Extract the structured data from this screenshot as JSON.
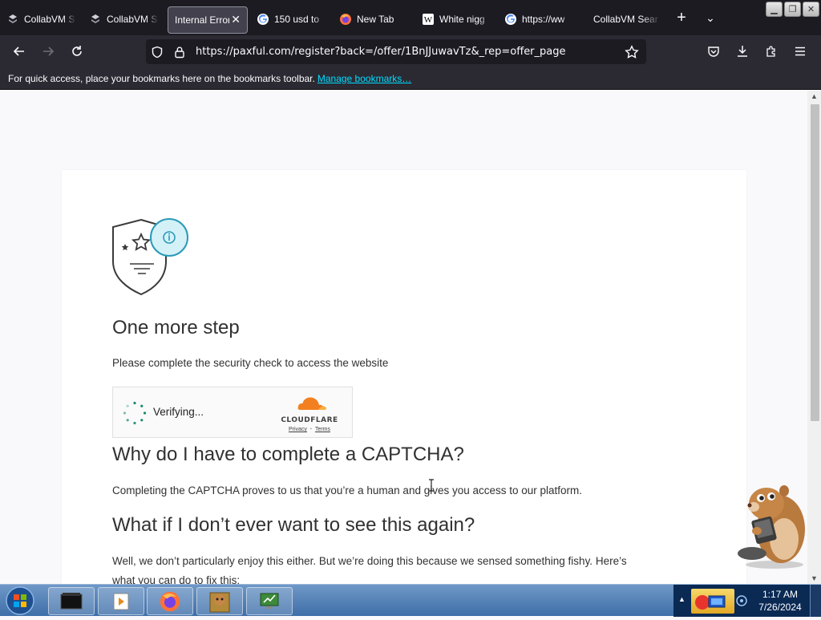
{
  "browser": {
    "tabs": [
      {
        "label": "CollabVM S",
        "icon": "collabvm-icon",
        "active": false
      },
      {
        "label": "CollabVM S",
        "icon": "collabvm-icon",
        "active": false
      },
      {
        "label": "Internal Error",
        "icon": "none",
        "active": true
      },
      {
        "label": "150 usd to",
        "icon": "google-icon",
        "active": false
      },
      {
        "label": "New Tab",
        "icon": "firefox-icon",
        "active": false
      },
      {
        "label": "White nigg",
        "icon": "wikipedia-icon",
        "active": false
      },
      {
        "label": "https://ww",
        "icon": "google-icon",
        "active": false
      },
      {
        "label": "CollabVM Sear",
        "icon": "none",
        "active": false
      }
    ],
    "new_tab_symbol": "+",
    "list_tabs_symbol": "⌄",
    "url": "https://paxful.com/register?back=/offer/1BnJJuwavTz&_rep=offer_page",
    "bookmarks_hint": "For quick access, place your bookmarks here on the bookmarks toolbar.",
    "bookmarks_link": "Manage bookmarks…"
  },
  "page": {
    "heading_step": "One more step",
    "subtitle": "Please complete the security check to access the website",
    "captcha": {
      "status": "Verifying...",
      "brand": "CLOUDFLARE",
      "privacy": "Privacy",
      "separator": "·",
      "terms": "Terms"
    },
    "why_heading": "Why do I have to complete a CAPTCHA?",
    "why_text": "Completing the CAPTCHA proves to us that you’re a human and gives you access to our platform.",
    "whatif_heading": "What if I don’t ever want to see this again?",
    "whatif_text_1": "Well, we don’t particularly enjoy this either. But we’re doing this because we sensed something fishy. Here’s",
    "whatif_text_2": "what you can do to fix this:"
  },
  "taskbar": {
    "time": "1:17 AM",
    "date": "7/26/2024",
    "apps": [
      "terminal-icon",
      "media-player-icon",
      "firefox-icon",
      "bonzi-box-icon",
      "monitor-icon"
    ]
  },
  "colors": {
    "accent_link": "#00ddff",
    "cloudflare_orange": "#f38020",
    "spinner_teal": "#1a8a6e",
    "info_teal": "#2a9ab7"
  }
}
